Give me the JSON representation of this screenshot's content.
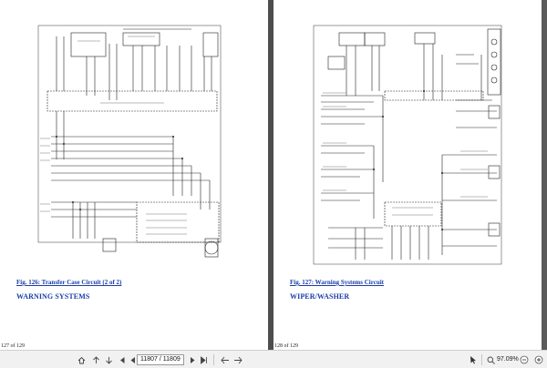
{
  "left_page": {
    "figure_caption": "Fig. 126: Transfer Case Circuit (2 of 2)",
    "next_section": "WARNING SYSTEMS",
    "page_number": "127 of 129"
  },
  "right_page": {
    "figure_caption": "Fig. 127: Warning Systems Circuit",
    "next_section": "WIPER/WASHER",
    "page_number": "128 of 129"
  },
  "toolbar": {
    "page_field_value": "11807 / 11809",
    "zoom_value": "97.09%",
    "icons": [
      "home-icon",
      "up-arrow-icon",
      "down-arrow-icon",
      "first-page-icon",
      "prev-page-icon",
      "next-page-icon",
      "last-page-icon",
      "back-icon",
      "forward-icon",
      "select-icon",
      "zoom-out-icon",
      "zoom-in-icon"
    ]
  },
  "colors": {
    "link_blue": "#1a3ea8",
    "viewer_bg": "#5b5b5b",
    "toolbar_bg": "#f1f1f1"
  }
}
